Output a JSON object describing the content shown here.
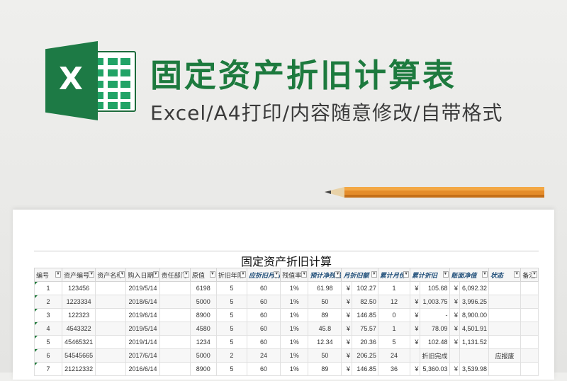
{
  "banner": {
    "title": "固定资产折旧计算表",
    "subtitle": "Excel/A4打印/内容随意修改/自带格式",
    "logo_letter": "X"
  },
  "sheet": {
    "title": "固定资产折旧计算",
    "headers": [
      "编号",
      "资产编号",
      "资产名称",
      "购入日期",
      "责任部门",
      "原值",
      "折旧年限",
      "应折旧月份",
      "残值率",
      "预计净残值",
      "月折旧额",
      "累计月份",
      "累计折旧",
      "账面净值",
      "状态",
      "备注"
    ],
    "rows": [
      [
        "1",
        "123456",
        "",
        "2019/5/14",
        "",
        "6198",
        "5",
        "60",
        "1%",
        "61.98",
        "¥",
        "102.27",
        "1",
        "¥",
        "105.68",
        "¥",
        "6,092.32",
        "",
        ""
      ],
      [
        "2",
        "1223334",
        "",
        "2018/6/14",
        "",
        "5000",
        "5",
        "60",
        "1%",
        "50",
        "¥",
        "82.50",
        "12",
        "¥",
        "1,003.75",
        "¥",
        "3,996.25",
        "",
        ""
      ],
      [
        "3",
        "122323",
        "",
        "2019/6/14",
        "",
        "8900",
        "5",
        "60",
        "1%",
        "89",
        "¥",
        "146.85",
        "0",
        "¥",
        "-",
        "¥",
        "8,900.00",
        "",
        ""
      ],
      [
        "4",
        "4543322",
        "",
        "2019/5/14",
        "",
        "4580",
        "5",
        "60",
        "1%",
        "45.8",
        "¥",
        "75.57",
        "1",
        "¥",
        "78.09",
        "¥",
        "4,501.91",
        "",
        ""
      ],
      [
        "5",
        "45465321",
        "",
        "2019/1/14",
        "",
        "1234",
        "5",
        "60",
        "1%",
        "12.34",
        "¥",
        "20.36",
        "5",
        "¥",
        "102.48",
        "¥",
        "1,131.52",
        "",
        ""
      ],
      [
        "6",
        "54545665",
        "",
        "2017/6/14",
        "",
        "5000",
        "2",
        "24",
        "1%",
        "50",
        "¥",
        "206.25",
        "24",
        "",
        "折旧完成",
        "",
        "",
        "应报废",
        ""
      ],
      [
        "7",
        "21212332",
        "",
        "2016/6/14",
        "",
        "8900",
        "5",
        "60",
        "1%",
        "89",
        "¥",
        "146.85",
        "36",
        "¥",
        "5,360.03",
        "¥",
        "3,539.98",
        "",
        ""
      ]
    ]
  },
  "colors": {
    "brand_green": "#1d7a3e",
    "header_blue": "#1f4e79"
  },
  "icons": {
    "logo": "excel-logo-icon",
    "filter": "filter-dropdown-icon",
    "pencil": "pencil-icon"
  }
}
